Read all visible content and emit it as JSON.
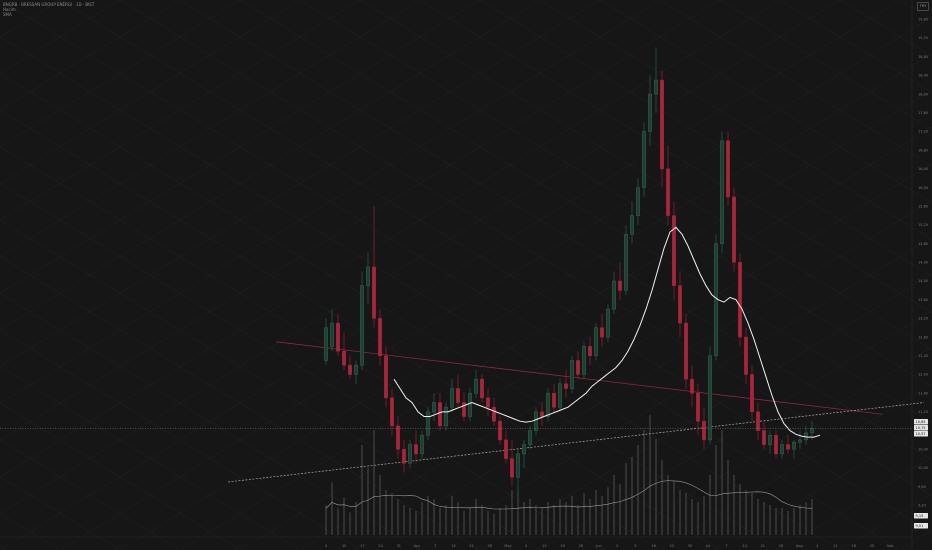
{
  "header": {
    "symbol_line": "BNGRB · BRESSAN GROUP ENERGI · 1D · BIST",
    "line2": "Hacim",
    "line3": "SMA"
  },
  "unit_badge": "TRY",
  "colors": {
    "background": "#161616",
    "up": "#2e6b52",
    "down": "#a8263b",
    "sma": "#f2f2f2",
    "red_trendline": "#9e2a3e",
    "dashed_trendline": "#cfcfcf",
    "volume": "#6c6c6c",
    "price_tag": "#e6e6e6"
  },
  "chart_data": {
    "type": "candlestick",
    "y_scale": "linear",
    "grid": "diagonal",
    "y_ticks": [
      "19,60",
      "19,20",
      "18,80",
      "18,40",
      "18,00",
      "17,60",
      "17,20",
      "16,80",
      "16,40",
      "16,00",
      "15,60",
      "15,20",
      "14,80",
      "14,40",
      "14,00",
      "13,60",
      "13,20",
      "12,80",
      "12,40",
      "12,00",
      "11,60",
      "11,20",
      "10,80",
      "10,40",
      "10,00",
      "9,60",
      "9,20"
    ],
    "y_tick_values": [
      19.6,
      19.2,
      18.8,
      18.4,
      18.0,
      17.6,
      17.2,
      16.8,
      16.4,
      16.0,
      15.6,
      15.2,
      14.8,
      14.4,
      14.0,
      13.6,
      13.2,
      12.8,
      12.4,
      12.0,
      11.6,
      11.2,
      10.8,
      10.4,
      10.0,
      9.6,
      9.2
    ],
    "x_ticks": [
      "3",
      "10",
      "17",
      "24",
      "31",
      "Apr",
      "7",
      "14",
      "21",
      "28",
      "May",
      "5",
      "12",
      "19",
      "26",
      "Jun",
      "2",
      "9",
      "16",
      "23",
      "30",
      "Jul",
      "7",
      "14",
      "21",
      "28",
      "Aug",
      "4",
      "11",
      "18",
      "25",
      "Sep"
    ],
    "price_tags": [
      "10,85",
      "10,75",
      "10,57",
      "9,15",
      "9,01"
    ],
    "ohlc": [
      [
        12.3,
        13.2,
        12.2,
        13.0
      ],
      [
        12.6,
        13.4,
        12.5,
        13.1
      ],
      [
        13.1,
        13.3,
        12.4,
        12.5
      ],
      [
        12.5,
        12.9,
        12.1,
        12.2
      ],
      [
        12.2,
        12.4,
        11.9,
        12.0
      ],
      [
        12.0,
        12.3,
        11.8,
        12.2
      ],
      [
        12.2,
        14.2,
        12.1,
        13.9
      ],
      [
        13.9,
        14.6,
        13.5,
        14.3
      ],
      [
        14.3,
        15.6,
        13.0,
        13.2
      ],
      [
        13.2,
        13.4,
        12.2,
        12.4
      ],
      [
        12.4,
        12.6,
        11.3,
        11.5
      ],
      [
        11.5,
        11.7,
        10.7,
        10.9
      ],
      [
        10.9,
        11.1,
        10.2,
        10.4
      ],
      [
        10.4,
        10.6,
        9.9,
        10.1
      ],
      [
        10.1,
        10.6,
        10.0,
        10.5
      ],
      [
        10.5,
        10.8,
        10.1,
        10.3
      ],
      [
        10.3,
        10.8,
        10.2,
        10.7
      ],
      [
        10.7,
        11.3,
        10.6,
        11.2
      ],
      [
        11.2,
        11.6,
        11.0,
        11.4
      ],
      [
        11.4,
        11.6,
        10.8,
        10.9
      ],
      [
        10.9,
        11.4,
        10.8,
        11.3
      ],
      [
        11.3,
        11.9,
        11.2,
        11.7
      ],
      [
        11.7,
        12.0,
        11.3,
        11.4
      ],
      [
        11.4,
        11.6,
        11.0,
        11.1
      ],
      [
        11.1,
        11.7,
        11.0,
        11.6
      ],
      [
        11.6,
        12.1,
        11.5,
        11.9
      ],
      [
        11.9,
        12.0,
        11.4,
        11.5
      ],
      [
        11.5,
        11.7,
        11.1,
        11.3
      ],
      [
        11.3,
        11.5,
        10.9,
        11.0
      ],
      [
        11.0,
        11.1,
        10.5,
        10.6
      ],
      [
        10.6,
        10.8,
        10.1,
        10.2
      ],
      [
        10.2,
        10.6,
        9.6,
        9.8
      ],
      [
        9.8,
        10.4,
        9.4,
        10.3
      ],
      [
        10.3,
        10.6,
        10.0,
        10.5
      ],
      [
        10.5,
        10.9,
        10.4,
        10.8
      ],
      [
        10.8,
        11.3,
        10.7,
        11.2
      ],
      [
        11.2,
        11.4,
        10.9,
        11.1
      ],
      [
        11.1,
        11.7,
        11.0,
        11.6
      ],
      [
        11.6,
        11.8,
        11.2,
        11.3
      ],
      [
        11.3,
        11.9,
        11.2,
        11.8
      ],
      [
        11.8,
        12.1,
        11.5,
        11.7
      ],
      [
        11.7,
        12.4,
        11.6,
        12.3
      ],
      [
        12.3,
        12.5,
        11.9,
        12.0
      ],
      [
        12.0,
        12.7,
        11.9,
        12.6
      ],
      [
        12.6,
        12.8,
        12.2,
        12.4
      ],
      [
        12.4,
        13.1,
        12.3,
        13.0
      ],
      [
        13.0,
        13.3,
        12.6,
        12.8
      ],
      [
        12.8,
        13.5,
        12.7,
        13.4
      ],
      [
        13.4,
        14.2,
        13.3,
        14.0
      ],
      [
        14.0,
        14.4,
        13.6,
        13.8
      ],
      [
        13.8,
        15.2,
        13.7,
        15.0
      ],
      [
        15.0,
        15.7,
        14.8,
        15.4
      ],
      [
        15.4,
        16.2,
        15.2,
        16.0
      ],
      [
        16.0,
        17.4,
        15.8,
        17.2
      ],
      [
        17.2,
        18.4,
        16.9,
        18.0
      ],
      [
        18.0,
        19.0,
        17.6,
        18.3
      ],
      [
        18.3,
        18.5,
        16.0,
        16.4
      ],
      [
        16.4,
        16.9,
        15.2,
        15.4
      ],
      [
        15.4,
        15.7,
        13.6,
        13.9
      ],
      [
        13.9,
        14.2,
        12.8,
        13.1
      ],
      [
        13.1,
        13.3,
        11.7,
        11.9
      ],
      [
        11.9,
        12.2,
        11.3,
        11.6
      ],
      [
        11.6,
        11.8,
        10.7,
        11.0
      ],
      [
        11.0,
        11.3,
        10.4,
        10.6
      ],
      [
        10.6,
        12.6,
        10.5,
        12.4
      ],
      [
        12.4,
        15.0,
        12.3,
        14.8
      ],
      [
        14.8,
        17.2,
        14.6,
        17.0
      ],
      [
        17.0,
        17.2,
        15.6,
        15.8
      ],
      [
        15.8,
        16.0,
        14.2,
        14.4
      ],
      [
        14.4,
        14.6,
        12.6,
        12.8
      ],
      [
        12.8,
        13.0,
        11.8,
        12.0
      ],
      [
        12.0,
        12.2,
        11.0,
        11.2
      ],
      [
        11.2,
        11.4,
        10.6,
        10.8
      ],
      [
        10.8,
        11.0,
        10.4,
        10.5
      ],
      [
        10.5,
        10.8,
        10.3,
        10.7
      ],
      [
        10.7,
        10.8,
        10.2,
        10.3
      ],
      [
        10.3,
        10.6,
        10.2,
        10.5
      ],
      [
        10.5,
        10.7,
        10.3,
        10.4
      ],
      [
        10.4,
        10.6,
        10.2,
        10.55
      ],
      [
        10.55,
        10.8,
        10.4,
        10.6
      ],
      [
        10.6,
        10.9,
        10.5,
        10.75
      ],
      [
        10.75,
        11.0,
        10.6,
        10.85
      ]
    ],
    "sma": [
      null,
      null,
      null,
      null,
      null,
      null,
      null,
      null,
      null,
      null,
      11.9,
      11.7,
      11.5,
      11.4,
      11.2,
      11.1,
      11.1,
      11.15,
      11.2,
      11.2,
      11.25,
      11.3,
      11.35,
      11.4,
      11.35,
      11.3,
      11.25,
      11.2,
      11.15,
      11.1,
      11.05,
      11.0,
      10.98,
      11.0,
      11.05,
      11.1,
      11.15,
      11.2,
      11.25,
      11.3,
      11.4,
      11.5,
      11.6,
      11.75,
      11.85,
      11.95,
      12.05,
      12.15,
      12.3,
      12.5,
      12.75,
      13.05,
      13.4,
      13.8,
      14.25,
      14.7,
      15.05,
      15.15,
      15.0,
      14.75,
      14.45,
      14.15,
      13.9,
      13.7,
      13.6,
      13.55,
      13.65,
      13.6,
      13.4,
      13.1,
      12.75,
      12.35,
      11.95,
      11.55,
      11.2,
      10.95,
      10.8,
      10.72,
      10.68,
      10.66,
      10.66,
      10.7
    ],
    "volume": [
      20,
      35,
      18,
      25,
      15,
      22,
      60,
      45,
      70,
      40,
      30,
      28,
      24,
      20,
      18,
      16,
      22,
      26,
      24,
      18,
      20,
      26,
      22,
      16,
      18,
      24,
      20,
      16,
      14,
      18,
      20,
      30,
      28,
      22,
      24,
      20,
      18,
      22,
      20,
      24,
      22,
      26,
      20,
      28,
      24,
      30,
      26,
      32,
      40,
      34,
      48,
      52,
      60,
      70,
      80,
      64,
      50,
      40,
      36,
      30,
      28,
      24,
      22,
      26,
      40,
      60,
      70,
      50,
      40,
      34,
      30,
      28,
      24,
      22,
      20,
      18,
      18,
      16,
      18,
      20,
      22,
      24
    ],
    "trendlines": [
      {
        "style": "solid",
        "from": [
          0,
          12.7
        ],
        "to": [
          81,
          11.15
        ]
      },
      {
        "style": "dashed",
        "from": [
          -8,
          9.7
        ],
        "to": [
          88,
          11.4
        ]
      }
    ]
  }
}
